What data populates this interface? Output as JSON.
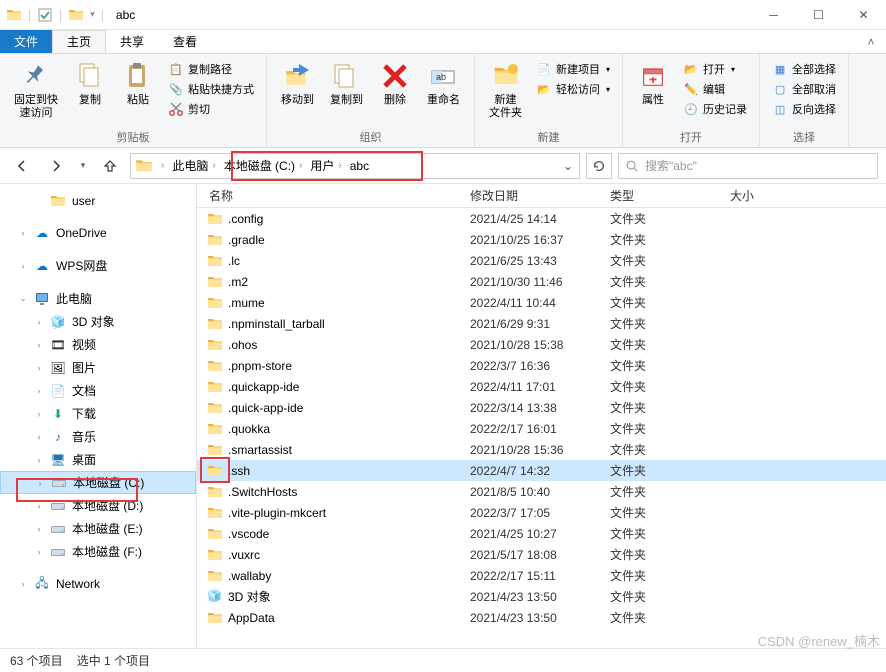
{
  "window": {
    "title": "abc"
  },
  "tabs": {
    "file": "文件",
    "home": "主页",
    "share": "共享",
    "view": "查看"
  },
  "ribbon": {
    "clipboard": {
      "pin": "固定到快\n速访问",
      "copy": "复制",
      "paste": "粘贴",
      "copypath": "复制路径",
      "pasteshortcut": "粘贴快捷方式",
      "cut": "剪切",
      "label": "剪贴板"
    },
    "organize": {
      "moveto": "移动到",
      "copyto": "复制到",
      "delete": "删除",
      "rename": "重命名",
      "label": "组织"
    },
    "new": {
      "newfolder": "新建\n文件夹",
      "newitem": "新建项目",
      "easyaccess": "轻松访问",
      "label": "新建"
    },
    "open": {
      "properties": "属性",
      "open": "打开",
      "edit": "编辑",
      "history": "历史记录",
      "label": "打开"
    },
    "select": {
      "all": "全部选择",
      "none": "全部取消",
      "invert": "反向选择",
      "label": "选择"
    }
  },
  "breadcrumbs": [
    "此电脑",
    "本地磁盘 (C:)",
    "用户",
    "abc"
  ],
  "search": {
    "placeholder": "搜索\"abc\""
  },
  "columns": {
    "name": "名称",
    "date": "修改日期",
    "type": "类型",
    "size": "大小"
  },
  "nav": {
    "user": "user",
    "onedrive": "OneDrive",
    "wps": "WPS网盘",
    "thispc": "此电脑",
    "obj3d": "3D 对象",
    "videos": "视频",
    "pictures": "图片",
    "documents": "文档",
    "downloads": "下载",
    "music": "音乐",
    "desktop": "桌面",
    "diskC": "本地磁盘 (C:)",
    "diskD": "本地磁盘 (D:)",
    "diskE": "本地磁盘 (E:)",
    "diskF": "本地磁盘 (F:)",
    "network": "Network"
  },
  "files": [
    {
      "name": ".config",
      "date": "2021/4/25 14:14",
      "type": "文件夹",
      "icon": "folder"
    },
    {
      "name": ".gradle",
      "date": "2021/10/25 16:37",
      "type": "文件夹",
      "icon": "folder"
    },
    {
      "name": ".lc",
      "date": "2021/6/25 13:43",
      "type": "文件夹",
      "icon": "folder"
    },
    {
      "name": ".m2",
      "date": "2021/10/30 11:46",
      "type": "文件夹",
      "icon": "folder"
    },
    {
      "name": ".mume",
      "date": "2022/4/11 10:44",
      "type": "文件夹",
      "icon": "folder"
    },
    {
      "name": ".npminstall_tarball",
      "date": "2021/6/29 9:31",
      "type": "文件夹",
      "icon": "folder"
    },
    {
      "name": ".ohos",
      "date": "2021/10/28 15:38",
      "type": "文件夹",
      "icon": "folder"
    },
    {
      "name": ".pnpm-store",
      "date": "2022/3/7 16:36",
      "type": "文件夹",
      "icon": "folder"
    },
    {
      "name": ".quickapp-ide",
      "date": "2022/4/11 17:01",
      "type": "文件夹",
      "icon": "folder"
    },
    {
      "name": ".quick-app-ide",
      "date": "2022/3/14 13:38",
      "type": "文件夹",
      "icon": "folder"
    },
    {
      "name": ".quokka",
      "date": "2022/2/17 16:01",
      "type": "文件夹",
      "icon": "folder"
    },
    {
      "name": ".smartassist",
      "date": "2021/10/28 15:36",
      "type": "文件夹",
      "icon": "folder"
    },
    {
      "name": ".ssh",
      "date": "2022/4/7 14:32",
      "type": "文件夹",
      "icon": "folder",
      "selected": true
    },
    {
      "name": ".SwitchHosts",
      "date": "2021/8/5 10:40",
      "type": "文件夹",
      "icon": "folder"
    },
    {
      "name": ".vite-plugin-mkcert",
      "date": "2022/3/7 17:05",
      "type": "文件夹",
      "icon": "folder"
    },
    {
      "name": ".vscode",
      "date": "2021/4/25 10:27",
      "type": "文件夹",
      "icon": "folder"
    },
    {
      "name": ".vuxrc",
      "date": "2021/5/17 18:08",
      "type": "文件夹",
      "icon": "folder"
    },
    {
      "name": ".wallaby",
      "date": "2022/2/17 15:11",
      "type": "文件夹",
      "icon": "folder"
    },
    {
      "name": "3D 对象",
      "date": "2021/4/23 13:50",
      "type": "文件夹",
      "icon": "3d"
    },
    {
      "name": "AppData",
      "date": "2021/4/23 13:50",
      "type": "文件夹",
      "icon": "folder"
    }
  ],
  "status": {
    "count": "63 个项目",
    "selected": "选中 1 个项目"
  },
  "watermark": "CSDN @renew_楠木"
}
